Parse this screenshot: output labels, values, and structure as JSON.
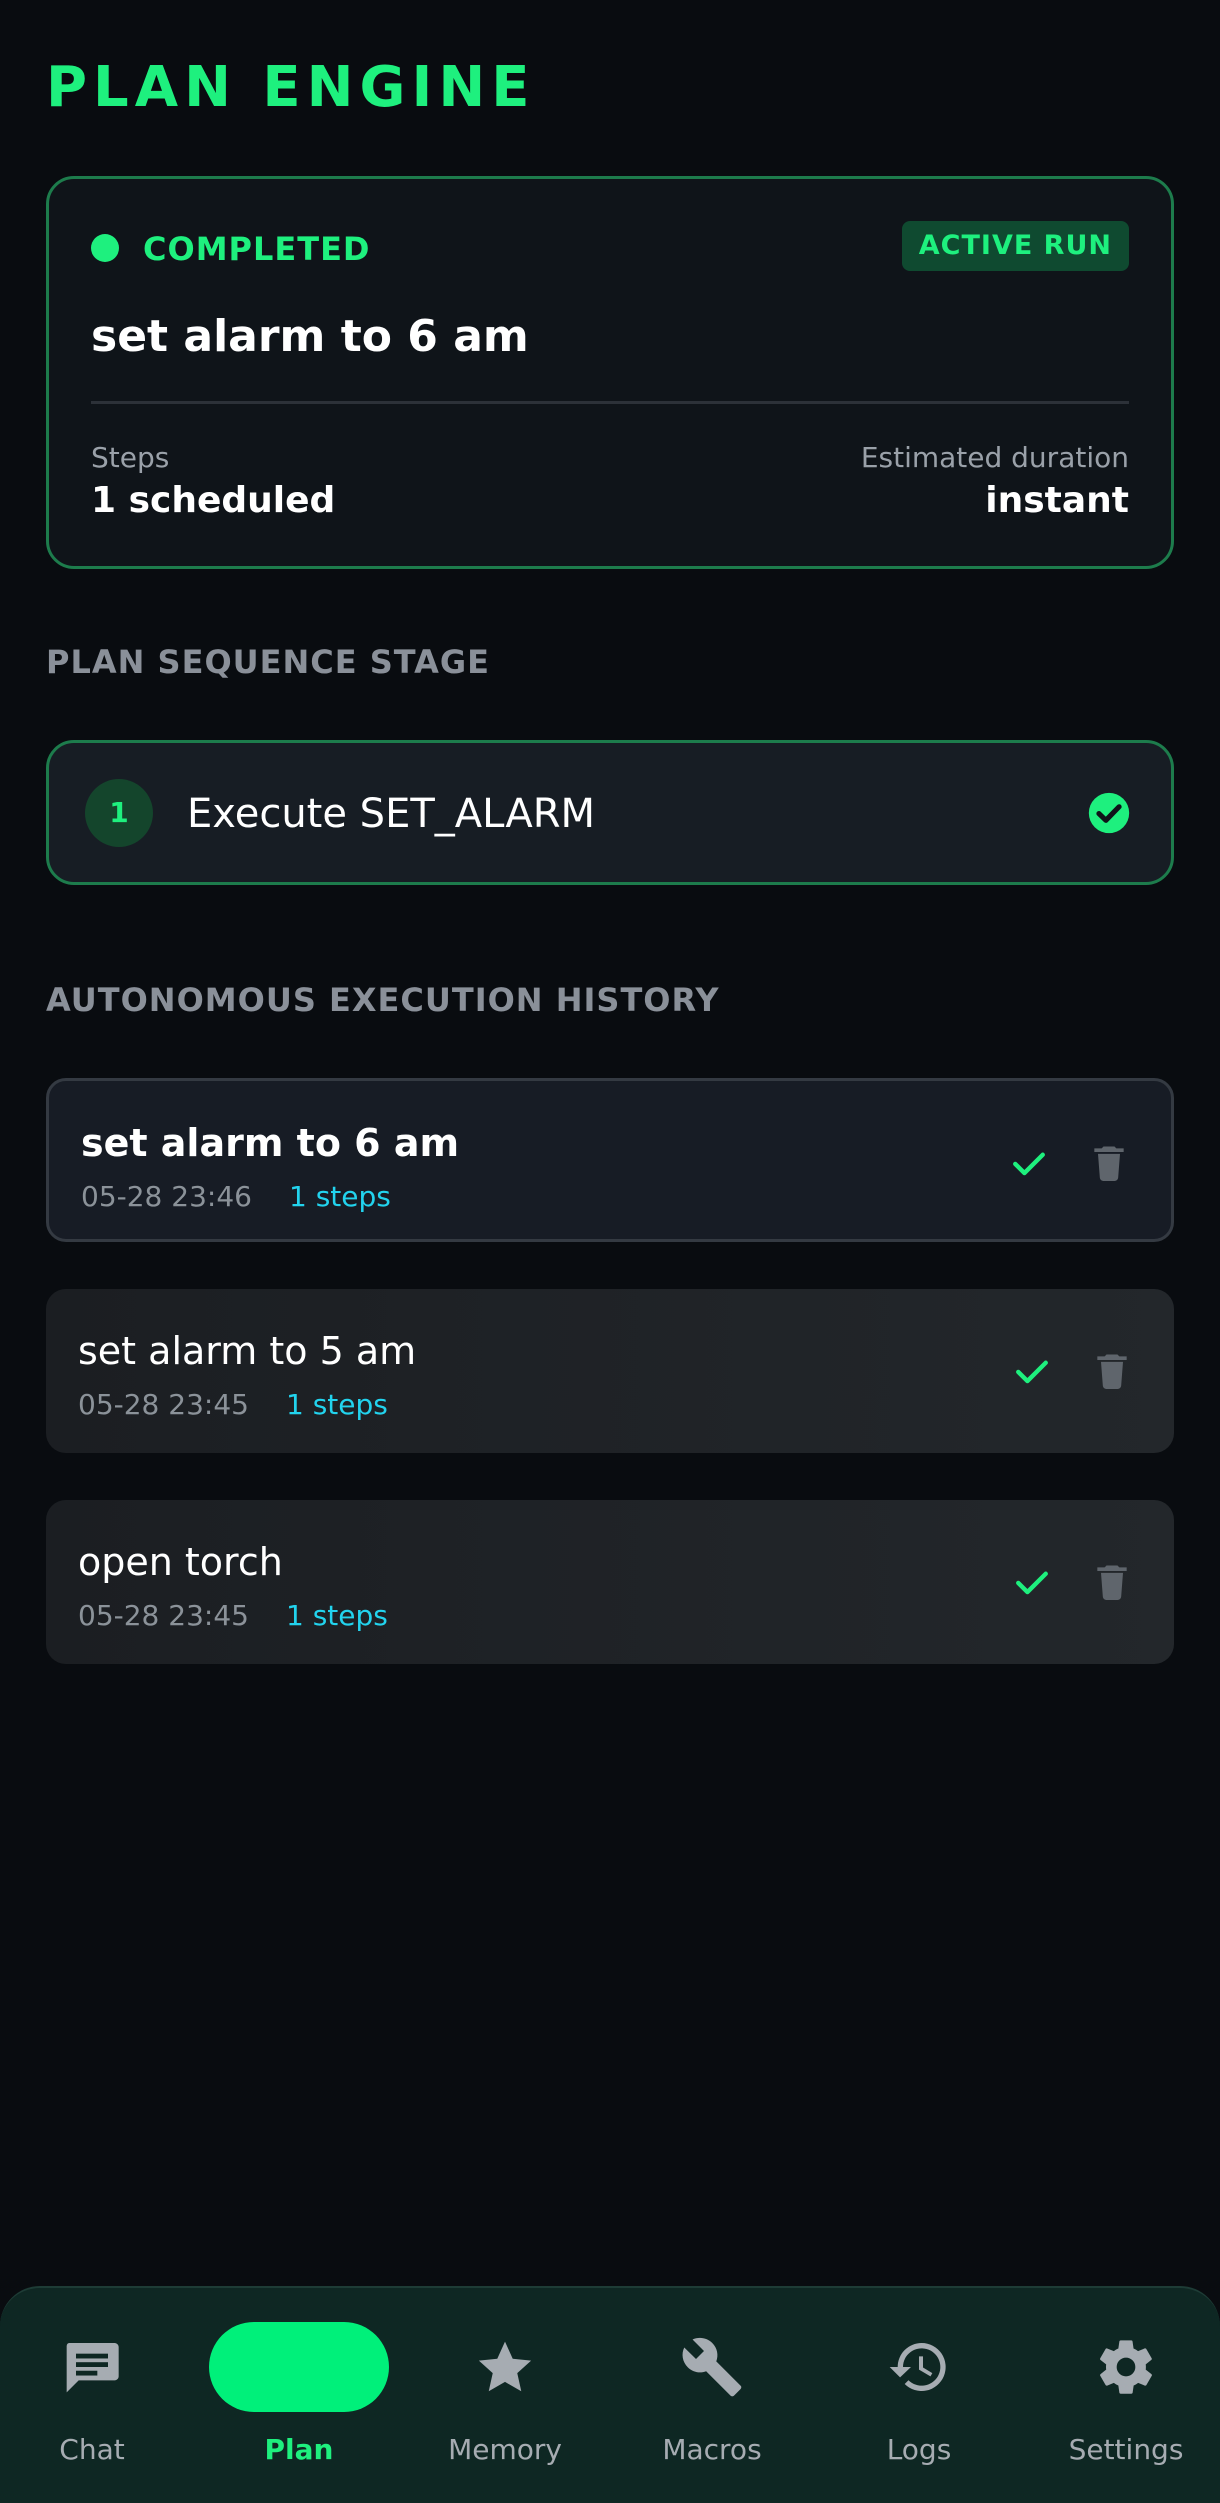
{
  "header": {
    "title": "PLAN ENGINE"
  },
  "active_run": {
    "status": "COMPLETED",
    "badge": "ACTIVE RUN",
    "title": "set alarm to 6 am",
    "steps_label": "Steps",
    "steps_value": "1 scheduled",
    "duration_label": "Estimated duration",
    "duration_value": "instant"
  },
  "sequence": {
    "header": "PLAN SEQUENCE STAGE",
    "stages": [
      {
        "number": "1",
        "label": "Execute SET_ALARM"
      }
    ]
  },
  "history": {
    "header": "AUTONOMOUS EXECUTION HISTORY",
    "items": [
      {
        "title": "set alarm to 6 am",
        "timestamp": "05-28 23:46",
        "steps": "1 steps"
      },
      {
        "title": "set alarm to 5 am",
        "timestamp": "05-28 23:45",
        "steps": "1 steps"
      },
      {
        "title": "open torch",
        "timestamp": "05-28 23:45",
        "steps": "1 steps"
      }
    ]
  },
  "nav": {
    "items": [
      {
        "label": "Chat",
        "icon": "chat-icon"
      },
      {
        "label": "Plan",
        "icon": "plan-icon"
      },
      {
        "label": "Memory",
        "icon": "star-icon"
      },
      {
        "label": "Macros",
        "icon": "wrench-icon"
      },
      {
        "label": "Logs",
        "icon": "history-icon"
      },
      {
        "label": "Settings",
        "icon": "gear-icon"
      }
    ]
  },
  "colors": {
    "accent": "#1ef07e",
    "background": "#090c10",
    "card": "#0f1419",
    "steps_link": "#22d3ee",
    "nav_bar": "#0e2723"
  }
}
